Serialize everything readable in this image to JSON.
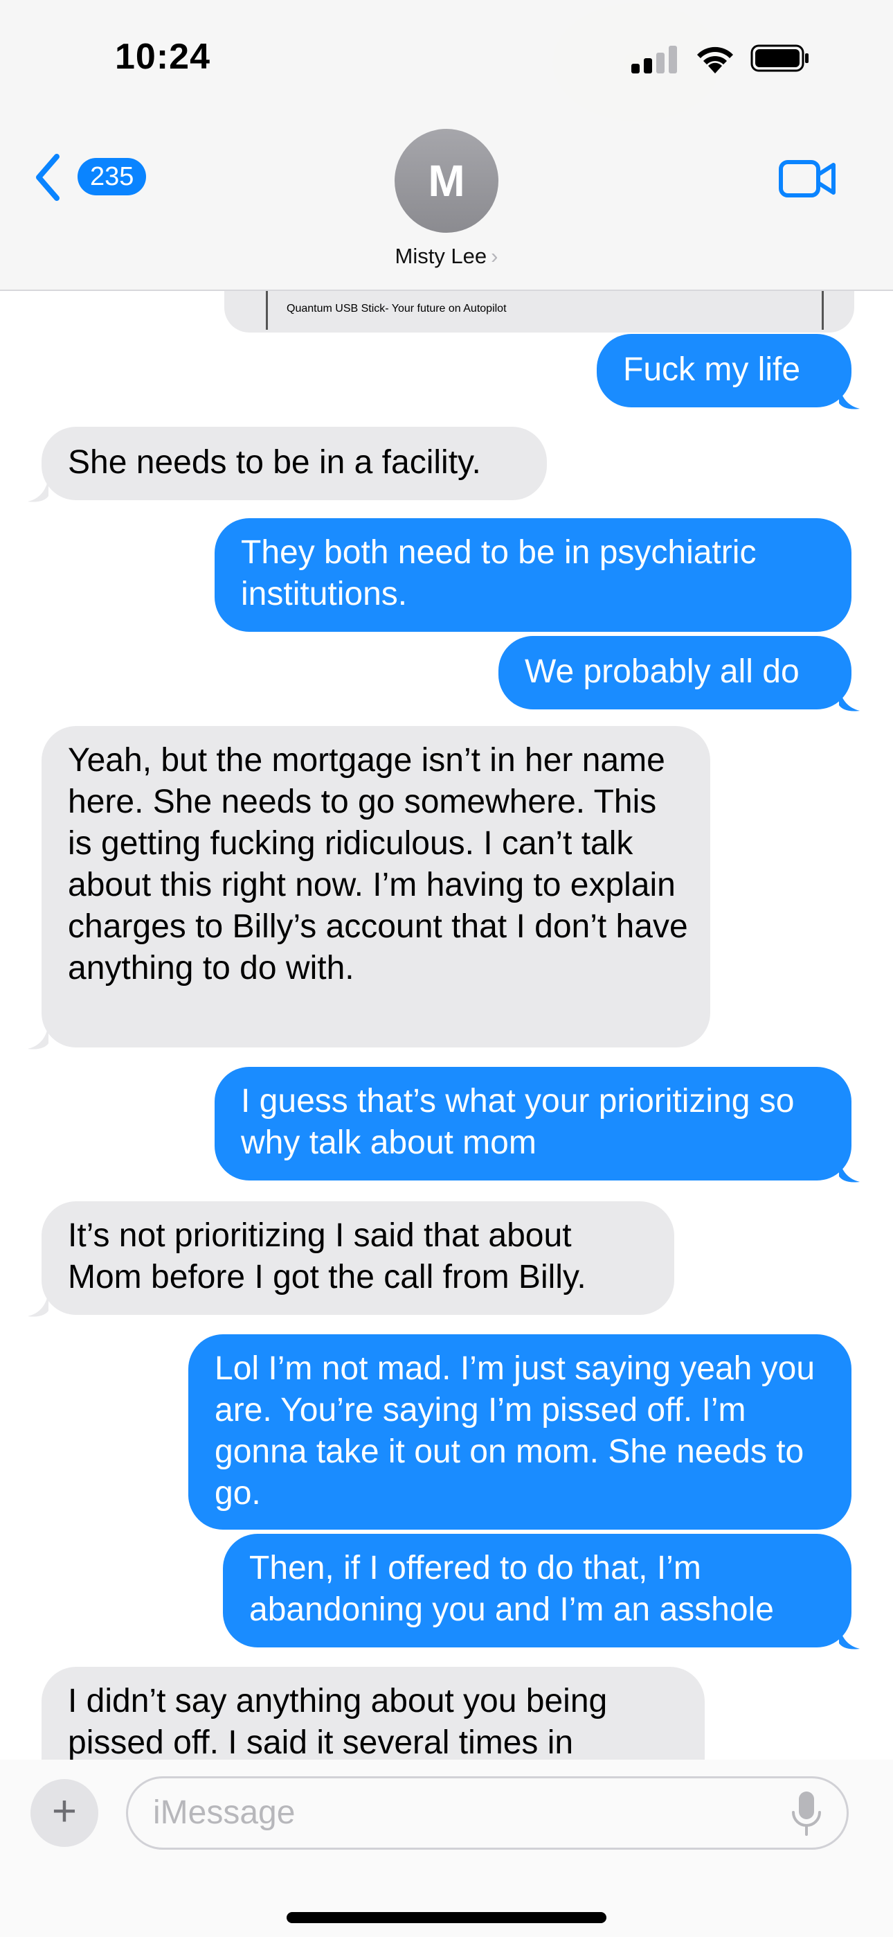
{
  "status_bar": {
    "time": "10:24"
  },
  "header": {
    "back_count": "235",
    "avatar_initial": "M",
    "contact_name": "Misty Lee"
  },
  "link_preview": {
    "title": "Quantum USB Stick- Your future on Autopilot"
  },
  "messages": [
    {
      "side": "out",
      "text": "Fuck my life"
    },
    {
      "side": "in",
      "text": "She needs to be in a facility."
    },
    {
      "side": "out",
      "text": "They both need to be in psychiatric institutions."
    },
    {
      "side": "out",
      "text": "We probably all do"
    },
    {
      "side": "in",
      "text": "Yeah, but the mortgage isn’t in her name here. She needs to go somewhere. This is getting fucking ridiculous. I can’t talk about this right now. I’m having to explain charges to Billy’s account that I don’t have anything to do with."
    },
    {
      "side": "out",
      "text": "I guess that’s what your prioritizing so why talk about mom"
    },
    {
      "side": "in",
      "text": "It’s not prioritizing I said that about Mom before I got the call from Billy."
    },
    {
      "side": "out",
      "text": "Lol I’m not mad. I’m just saying yeah you are. You’re saying I’m pissed off. I’m gonna take it out on mom. She needs to go."
    },
    {
      "side": "out",
      "text": "Then, if I offered to do that, I’m abandoning you and I’m an asshole"
    },
    {
      "side": "in",
      "text": "I didn’t say anything about you being pissed off. I said it several times in"
    }
  ],
  "input": {
    "placeholder": "iMessage"
  },
  "colors": {
    "outgoing": "#1a8cff",
    "incoming": "#e9e9eb",
    "accent": "#0a84ff"
  }
}
